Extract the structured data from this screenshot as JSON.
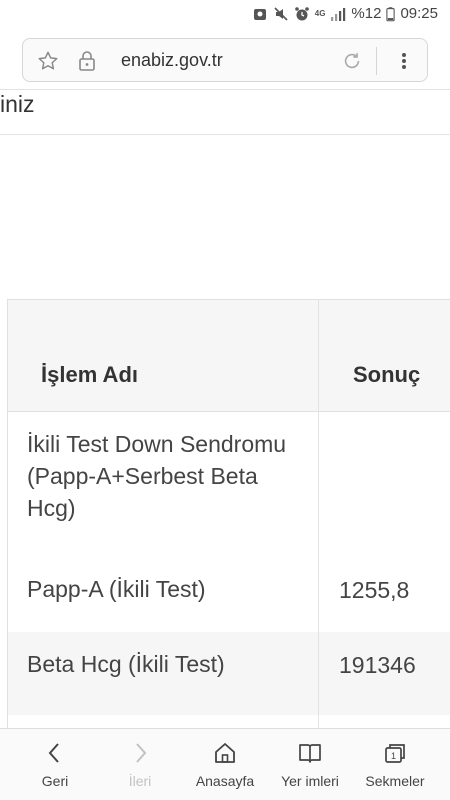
{
  "status_bar": {
    "network": "4G",
    "battery": "%12",
    "time": "09:25"
  },
  "url_bar": {
    "url": "enabiz.gov.tr"
  },
  "page": {
    "partial_title": "iniz",
    "table": {
      "headers": [
        "İşlem Adı",
        "Sonuç"
      ],
      "rows": [
        {
          "name": "İkili Test Down Sendromu (Papp-A+Serbest Beta Hcg)",
          "value": ""
        },
        {
          "name": "Papp-A (İkili Test)",
          "value": "1255,8"
        },
        {
          "name": "Beta Hcg (İkili Test)",
          "value": "191346"
        }
      ]
    }
  },
  "bottom_nav": {
    "items": [
      {
        "label": "Geri",
        "icon": "back-icon",
        "enabled": true
      },
      {
        "label": "İleri",
        "icon": "forward-icon",
        "enabled": false
      },
      {
        "label": "Anasayfa",
        "icon": "home-icon",
        "enabled": true
      },
      {
        "label": "Yer imleri",
        "icon": "bookmarks-icon",
        "enabled": true
      },
      {
        "label": "Sekmeler",
        "icon": "tabs-icon",
        "enabled": true
      }
    ]
  },
  "colors": {
    "header_bg": "#f6f6f6",
    "text": "#444444",
    "disabled": "#c2c2c2"
  }
}
